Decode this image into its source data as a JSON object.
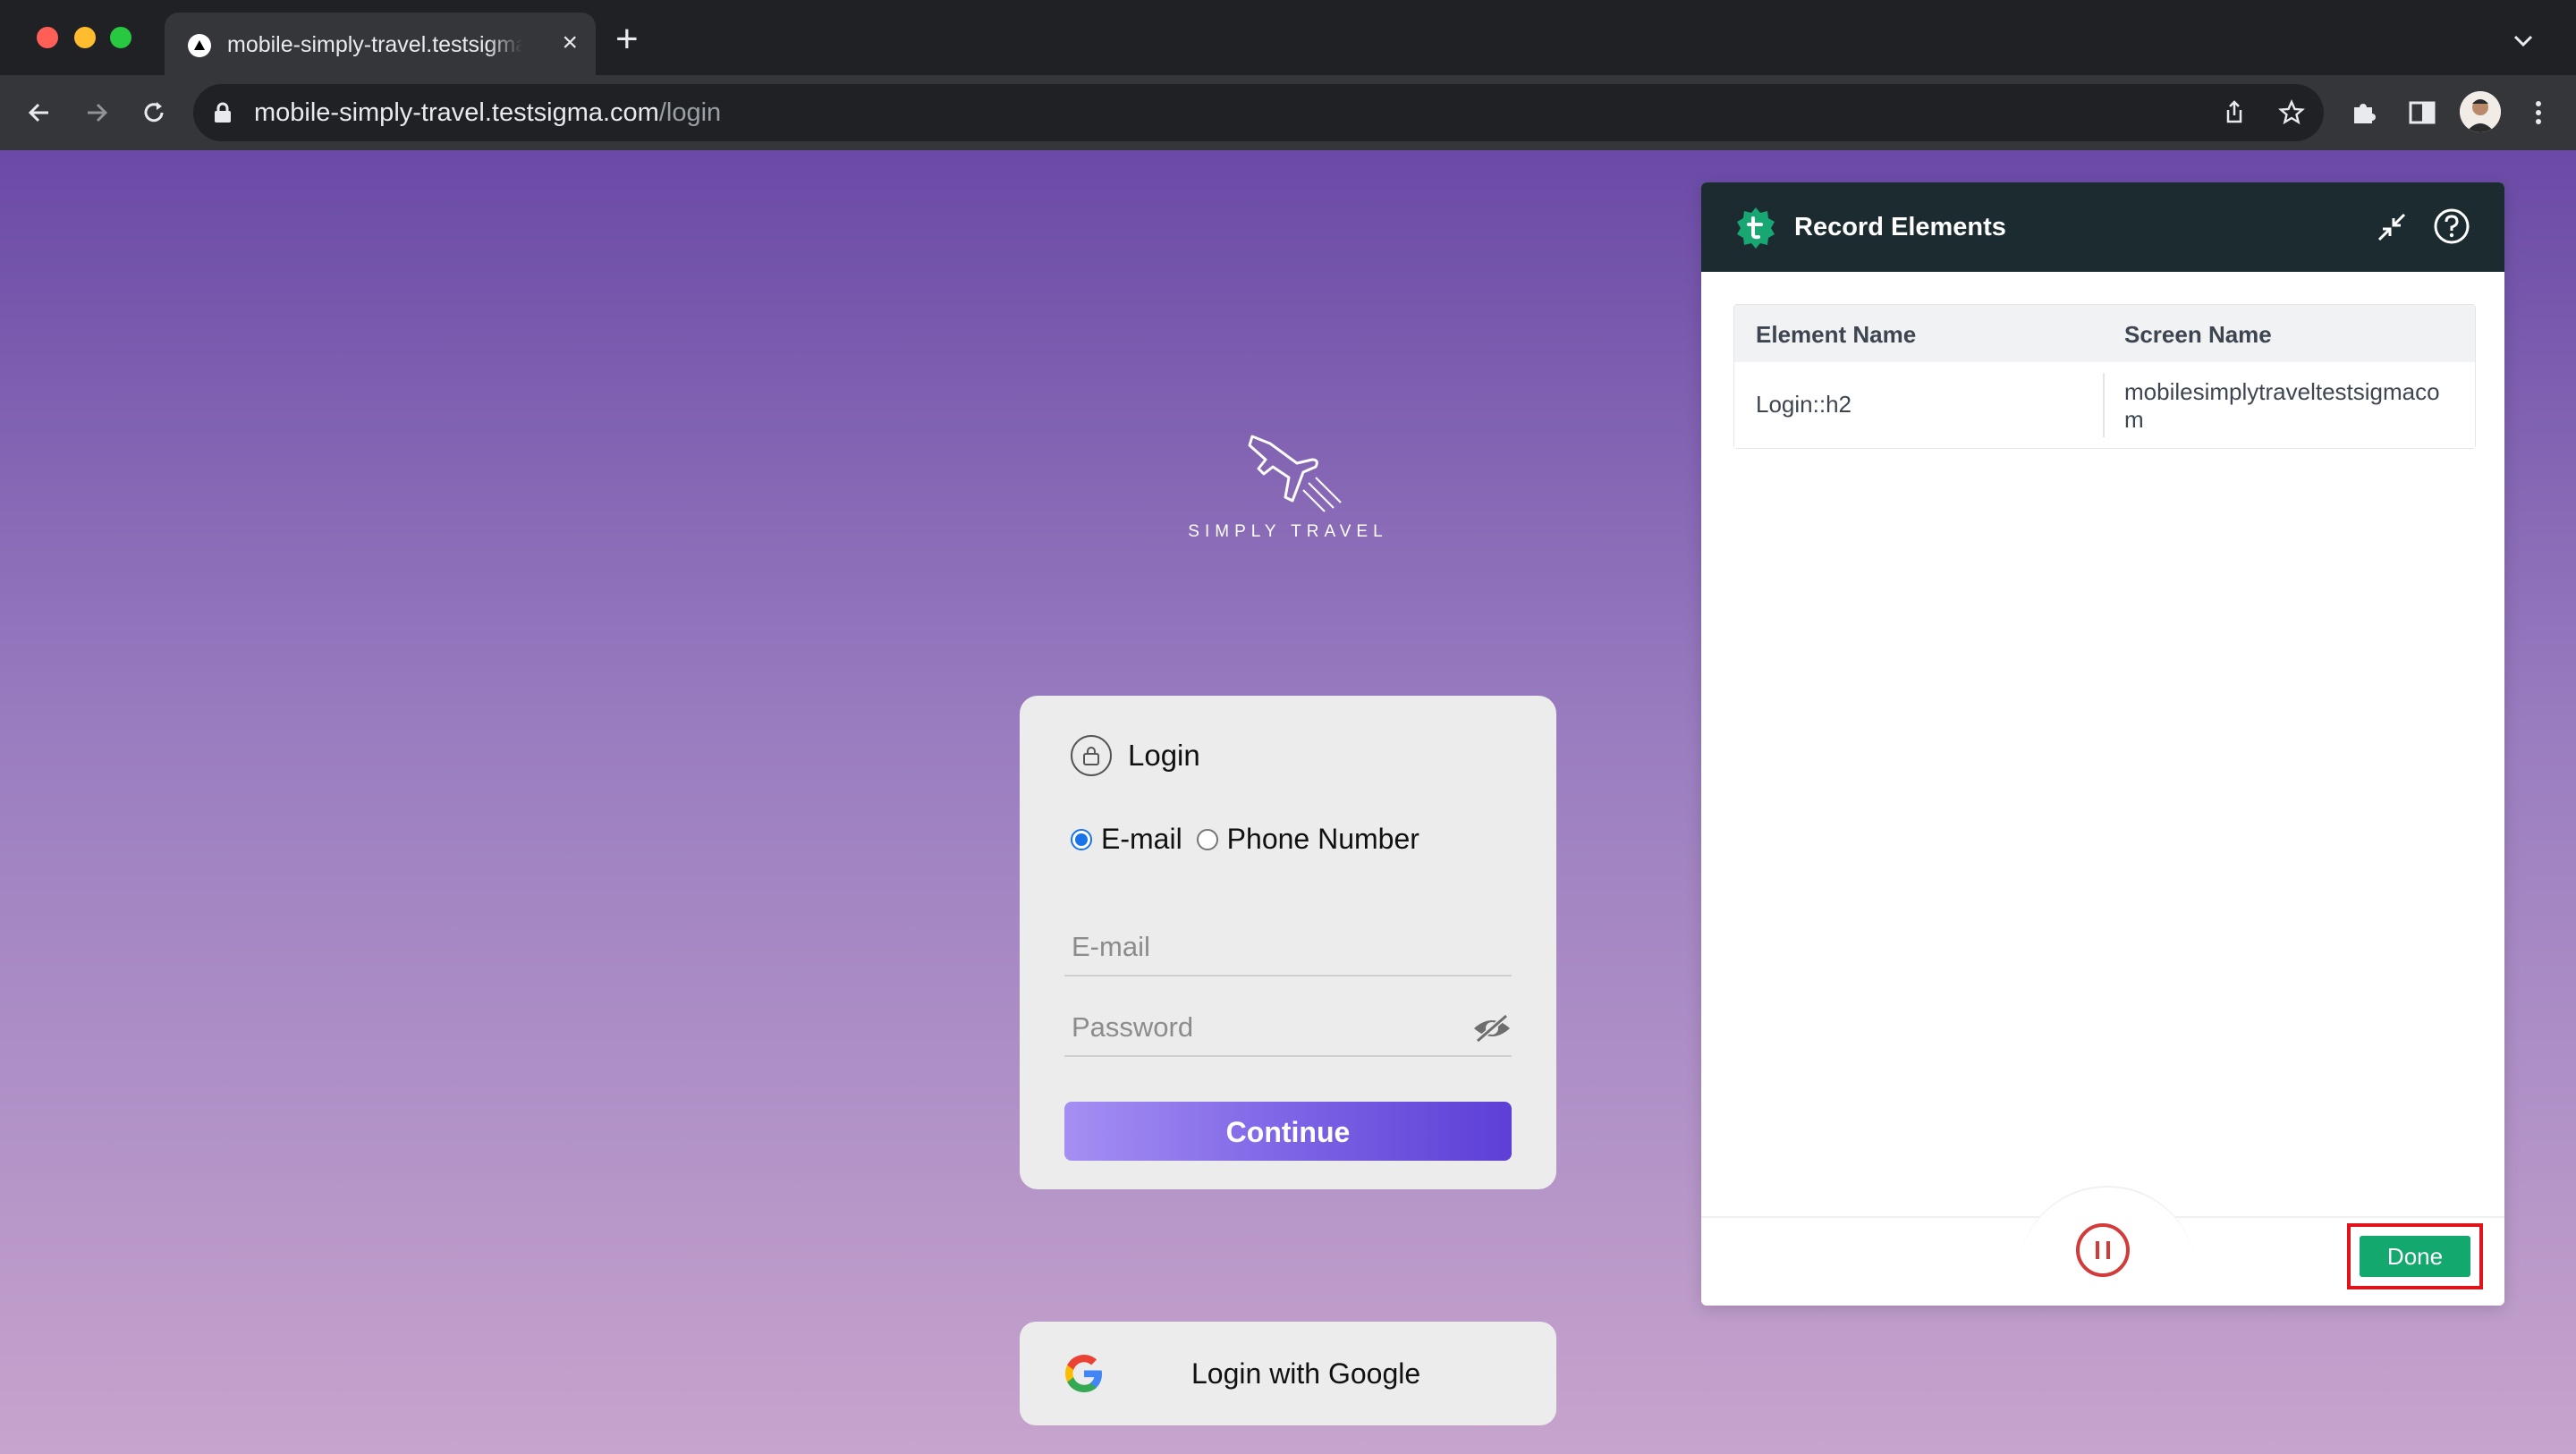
{
  "browser": {
    "tab_title": "mobile-simply-travel.testsigma.com",
    "url_host": "mobile-simply-travel.testsigma.com",
    "url_path": "/login"
  },
  "page": {
    "brand_name": "SIMPLY TRAVEL",
    "login": {
      "title": "Login",
      "radio_email": "E-mail",
      "radio_phone": "Phone Number",
      "selected": "E-mail",
      "email_placeholder": "E-mail",
      "password_placeholder": "Password",
      "continue_label": "Continue",
      "continue_gradient": [
        "#a58ff3",
        "#5d3fd6"
      ]
    },
    "google_label": "Login with Google"
  },
  "recorder": {
    "title": "Record Elements",
    "columns": [
      "Element Name",
      "Screen Name"
    ],
    "rows": [
      {
        "element": "Login::h2",
        "screen": "mobilesimplytraveltestsigmacom"
      }
    ],
    "done_label": "Done",
    "accent_color": "#12a86e",
    "highlight_color": "#e0131b"
  }
}
